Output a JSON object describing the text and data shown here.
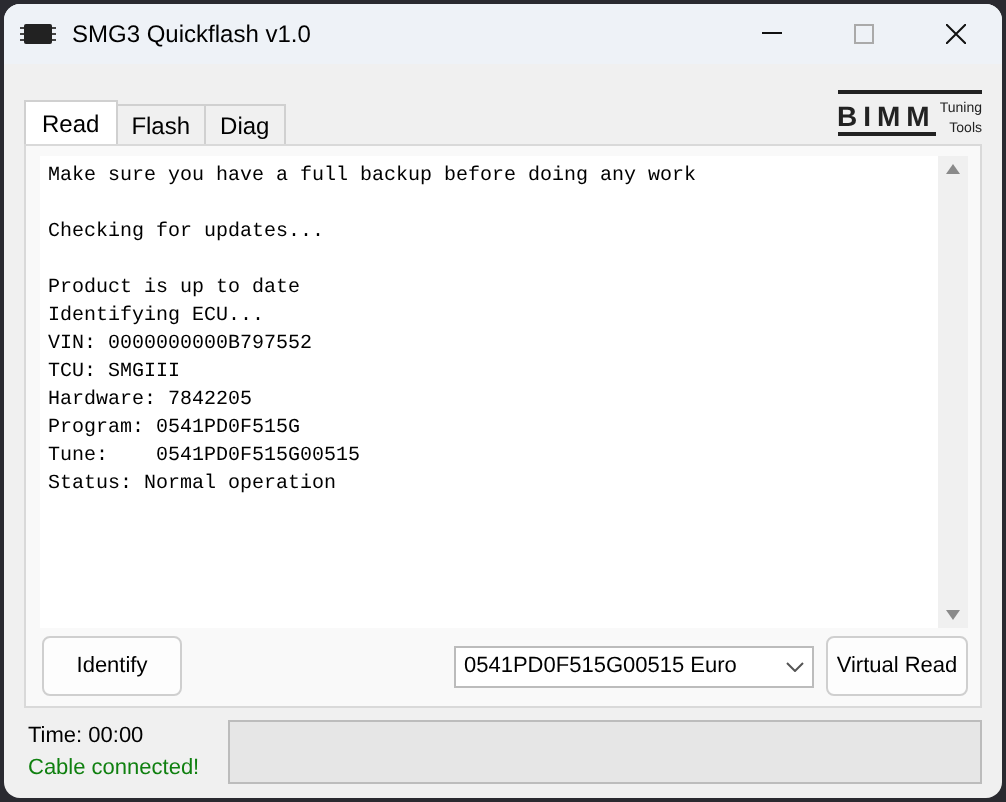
{
  "window": {
    "title": "SMG3 Quickflash v1.0"
  },
  "tabs": [
    {
      "label": "Read",
      "selected": true
    },
    {
      "label": "Flash",
      "selected": false
    },
    {
      "label": "Diag",
      "selected": false
    }
  ],
  "logo": {
    "name": "BIMM",
    "tagline_1": "Tuning",
    "tagline_2": "Tools"
  },
  "log": [
    [
      "Make sure you have a full backup before doing any work"
    ],
    [
      "Checking for updates..."
    ],
    [
      "Product is up to date",
      "Identifying ECU...",
      "VIN: 0000000000B797552",
      "TCU: SMGIII",
      "Hardware: 7842205",
      "Program: 0541PD0F515G",
      "Tune:    0541PD0F515G00515",
      "Status: Normal operation"
    ]
  ],
  "buttons": {
    "identify": "Identify",
    "virtual_read": "Virtual Read"
  },
  "tune_select": {
    "value": "0541PD0F515G00515 Euro"
  },
  "status": {
    "time": "Time: 00:00",
    "connection": "Cable connected!",
    "connected": true
  }
}
